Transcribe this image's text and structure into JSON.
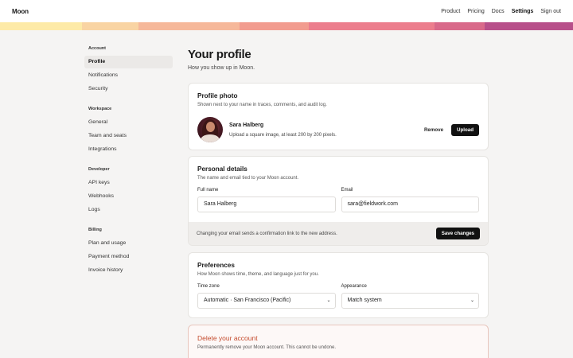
{
  "app": {
    "logo": "Moon"
  },
  "nav": {
    "product": "Product",
    "pricing": "Pricing",
    "docs": "Docs",
    "settings": "Settings",
    "sign_out": "Sign out"
  },
  "stripe_colors": [
    "#fdeaa7",
    "#f9d4a3",
    "#f6b89a",
    "#f29c8f",
    "#ec7e8d",
    "#d96a8a",
    "#b8508a"
  ],
  "sidebar": {
    "sections": [
      {
        "title": "Account",
        "items": [
          "Profile",
          "Notifications",
          "Security"
        ]
      },
      {
        "title": "Workspace",
        "items": [
          "General",
          "Team and seats",
          "Integrations"
        ]
      },
      {
        "title": "Developer",
        "items": [
          "API keys",
          "Webhooks",
          "Logs"
        ]
      },
      {
        "title": "Billing",
        "items": [
          "Plan and usage",
          "Payment method",
          "Invoice history"
        ]
      }
    ],
    "active": "Profile"
  },
  "main": {
    "title": "Your profile",
    "subtitle": "How you show up in Moon."
  },
  "photo": {
    "title": "Profile photo",
    "subtitle": "Shown next to your name in traces, comments, and audit log.",
    "name": "Sara Halberg",
    "hint": "Upload a square image, at least 200 by 200 pixels.",
    "remove": "Remove",
    "upload": "Upload"
  },
  "personal": {
    "title": "Personal details",
    "subtitle": "The name and email tied to your Moon account.",
    "full_name_label": "Full name",
    "full_name": "Sara Halberg",
    "email_label": "Email",
    "email": "sara@fieldwork.com",
    "footer_note": "Changing your email sends a confirmation link to the new address.",
    "save": "Save changes"
  },
  "preferences": {
    "title": "Preferences",
    "subtitle": "How Moon shows time, theme, and language just for you.",
    "timezone_label": "Time zone",
    "timezone": "Automatic · San Francisco (Pacific)",
    "appearance_label": "Appearance",
    "appearance": "Match system"
  },
  "danger": {
    "title": "Delete your account",
    "subtitle": "Permanently remove your Moon account. This cannot be undone."
  }
}
